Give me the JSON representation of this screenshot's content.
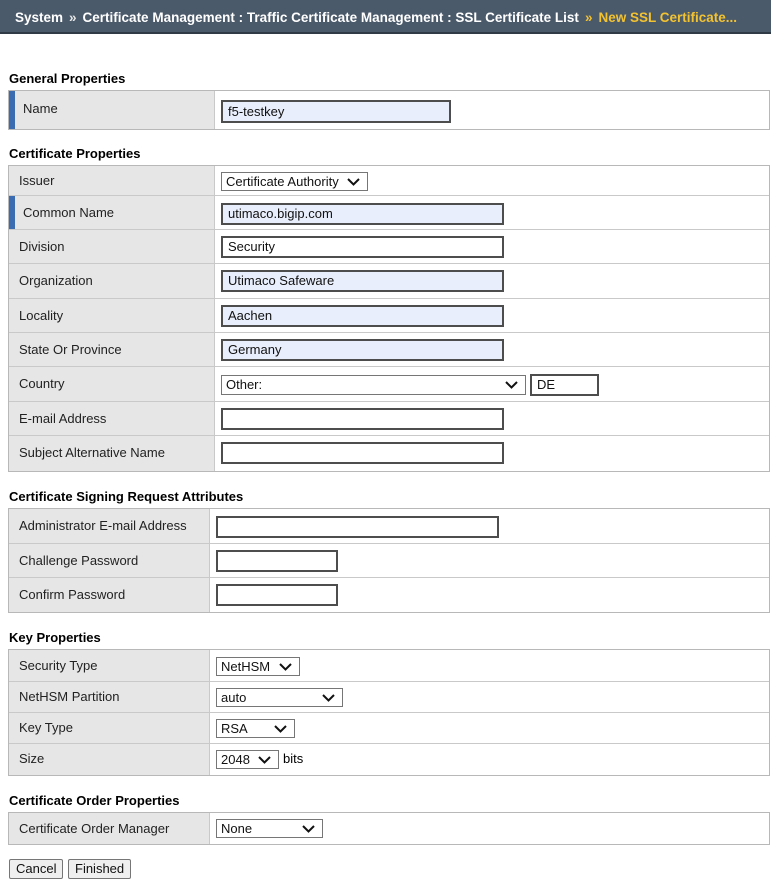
{
  "breadcrumb": {
    "items": [
      "System",
      "Certificate Management : Traffic Certificate Management : SSL Certificate List"
    ],
    "current": "New SSL Certificate...",
    "separator": "»"
  },
  "general": {
    "title": "General Properties",
    "name_label": "Name",
    "name_value": "f5-testkey"
  },
  "certificate": {
    "title": "Certificate Properties",
    "issuer_label": "Issuer",
    "issuer_value": "Certificate Authority",
    "common_name_label": "Common Name",
    "common_name_value": "utimaco.bigip.com",
    "division_label": "Division",
    "division_value": "Security",
    "organization_label": "Organization",
    "organization_value": "Utimaco Safeware",
    "locality_label": "Locality",
    "locality_value": "Aachen",
    "state_label": "State Or Province",
    "state_value": "Germany",
    "country_label": "Country",
    "country_select": "Other:",
    "country_code": "DE",
    "email_label": "E-mail Address",
    "email_value": "",
    "san_label": "Subject Alternative Name",
    "san_value": ""
  },
  "csr": {
    "title": "Certificate Signing Request Attributes",
    "admin_email_label": "Administrator E-mail Address",
    "admin_email_value": "",
    "challenge_label": "Challenge Password",
    "challenge_value": "",
    "confirm_label": "Confirm Password",
    "confirm_value": ""
  },
  "key": {
    "title": "Key Properties",
    "security_type_label": "Security Type",
    "security_type_value": "NetHSM",
    "partition_label": "NetHSM Partition",
    "partition_value": "auto",
    "key_type_label": "Key Type",
    "key_type_value": "RSA",
    "size_label": "Size",
    "size_value": "2048",
    "size_unit": "bits"
  },
  "order": {
    "title": "Certificate Order Properties",
    "manager_label": "Certificate Order Manager",
    "manager_value": "None"
  },
  "buttons": {
    "cancel": "Cancel",
    "finished": "Finished"
  },
  "colors": {
    "header_bg": "#4b5a6b",
    "current_crumb": "#f2c230",
    "required_marker": "#3b6bb0",
    "filled_input": "#e8eefb"
  }
}
